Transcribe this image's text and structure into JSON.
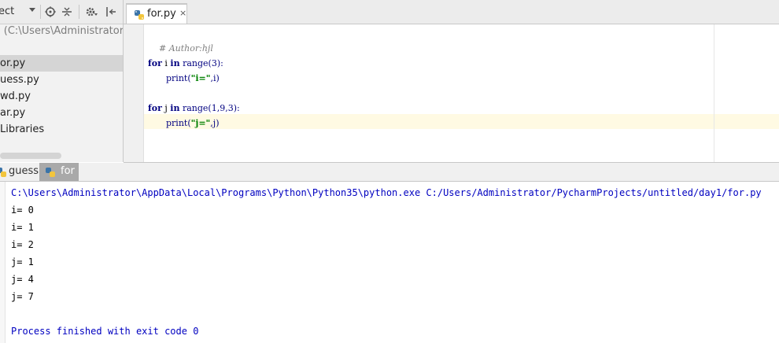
{
  "project_panel": {
    "view_label": "ect",
    "root_label": "l (C:\\Users\\Administrator\\Py",
    "items": [
      {
        "label": "or.py",
        "selected": true
      },
      {
        "label": "uess.py",
        "selected": false
      },
      {
        "label": "wd.py",
        "selected": false
      },
      {
        "label": "ar.py",
        "selected": false
      },
      {
        "label": " Libraries",
        "selected": false
      }
    ],
    "toolbar_icons": [
      "target-icon",
      "collapse-icon",
      "gear-icon",
      "pin-icon"
    ]
  },
  "editor": {
    "tab_label": "for.py",
    "tab_close": "×",
    "code": {
      "comment": "# Author:hjl",
      "l1_kw": "for",
      "l1_var": " i ",
      "l1_in": "in",
      "l1_rest": " range(3):",
      "l2_fn": "print(",
      "l2_str": "\"i=\"",
      "l2_rest": ",i)",
      "l3_kw": "for",
      "l3_var": " j ",
      "l3_in": "in",
      "l3_rest": " range(1,9,3):",
      "l4_fn": "print(",
      "l4_str": "\"j=\"",
      "l4_rest": ",j)"
    }
  },
  "run_panel": {
    "tabs": [
      {
        "label": "guess"
      },
      {
        "label": "for",
        "active": true
      }
    ],
    "command": "C:\\Users\\Administrator\\AppData\\Local\\Programs\\Python\\Python35\\python.exe C:/Users/Administrator/PycharmProjects/untitled/day1/for.py",
    "output": [
      "i= 0",
      "i= 1",
      "i= 2",
      "j= 1",
      "j= 4",
      "j= 7",
      ""
    ],
    "exit_message": "Process finished with exit code 0"
  },
  "colors": {
    "command_text": "#0000c0",
    "output_text": "#000000",
    "exit_text": "#0000c0",
    "keyword": "#000080",
    "string": "#008000"
  }
}
